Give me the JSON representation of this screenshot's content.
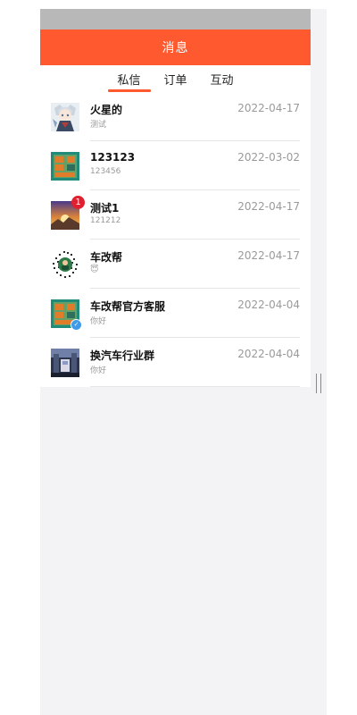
{
  "header": {
    "title": "消息"
  },
  "tabs": [
    {
      "label": "私信",
      "active": true
    },
    {
      "label": "订单",
      "active": false
    },
    {
      "label": "互动",
      "active": false
    }
  ],
  "messages": [
    {
      "name": "火星的",
      "preview": "测试",
      "date": "2022-04-17",
      "avatar": "anime-girl-avatar",
      "badge": ""
    },
    {
      "name": "123123",
      "preview": "123456",
      "date": "2022-03-02",
      "avatar": "teal-poster-avatar",
      "badge": ""
    },
    {
      "name": "测试1",
      "preview": "121212",
      "date": "2022-04-17",
      "avatar": "sunset-photo-avatar",
      "badge": "1"
    },
    {
      "name": "车改帮",
      "preview": "😇",
      "date": "2022-04-17",
      "avatar": "qr-code-avatar",
      "badge": ""
    },
    {
      "name": "车改帮官方客服",
      "preview": "你好",
      "date": "2022-04-04",
      "avatar": "teal-poster-avatar",
      "badge": "",
      "verified": "✓"
    },
    {
      "name": "换汽车行业群",
      "preview": "你好",
      "date": "2022-04-04",
      "avatar": "city-street-avatar",
      "badge": ""
    }
  ],
  "colors": {
    "accent": "#ff5a2f",
    "status_bar": "#b8b8b8",
    "badge": "#e0202f",
    "verified": "#3d9be9"
  }
}
